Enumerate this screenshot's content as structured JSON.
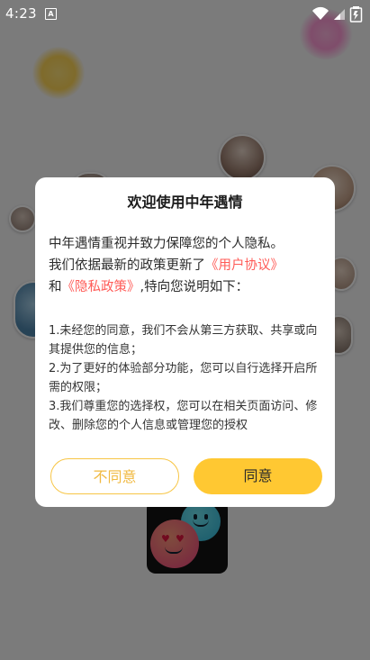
{
  "status_bar": {
    "time": "4:23",
    "notification_icon": "A",
    "icons": [
      "wifi-icon",
      "signal-icon",
      "battery-icon"
    ]
  },
  "dialog": {
    "title": "欢迎使用中年遇情",
    "intro_line1": "中年遇情重视并致力保障您的个人隐私。",
    "intro_line2_prefix": "我们依据最新的政策更新了",
    "user_agreement_link": "《用户协议》",
    "intro_line3_prefix": "和",
    "privacy_policy_link": "《隐私政策》",
    "intro_line3_suffix": ",特向您说明如下：",
    "points": [
      "1.未经您的同意，我们不会从第三方获取、共享或向其提供您的信息；",
      "2.为了更好的体验部分功能，您可以自行选择开启所需的权限；",
      "3.我们尊重您的选择权，您可以在相关页面访问、修改、删除您的个人信息或管理您的授权"
    ],
    "decline_label": "不同意",
    "agree_label": "同意"
  },
  "colors": {
    "overlay": "rgba(0,0,0,0.5)",
    "link": "#ff5b57",
    "accent_yellow": "#ffc832"
  }
}
